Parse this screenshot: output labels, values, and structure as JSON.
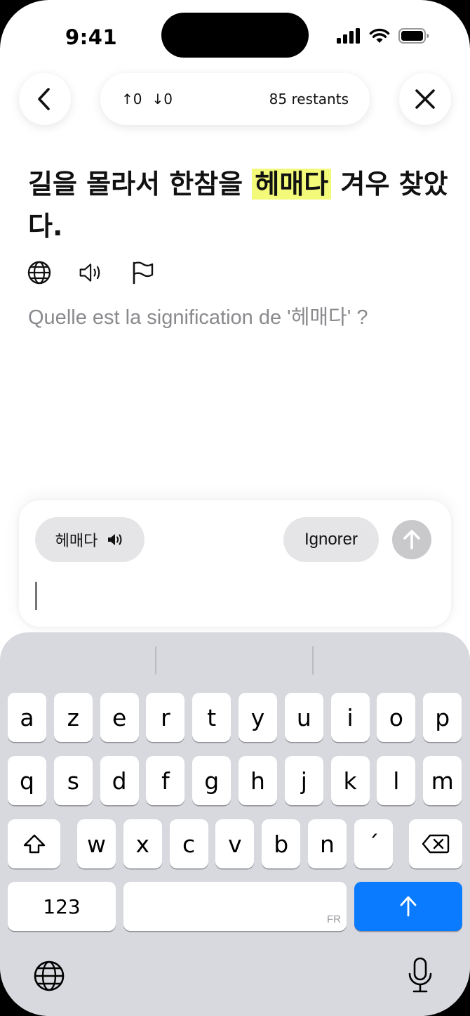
{
  "status_bar": {
    "time": "9:41"
  },
  "header": {
    "upvotes": "↑0",
    "downvotes": "↓0",
    "remaining": "85 restants"
  },
  "exercise": {
    "sentence_before": "길을 몰라서 한참을 ",
    "sentence_highlight": "헤매다",
    "sentence_after": " 겨우 찾았다.",
    "question": "Quelle est la signification de '헤매다' ?"
  },
  "composer": {
    "word_chip": "헤매다",
    "skip_label": "Ignorer"
  },
  "keyboard": {
    "row1": [
      "a",
      "z",
      "e",
      "r",
      "t",
      "y",
      "u",
      "i",
      "o",
      "p"
    ],
    "row2": [
      "q",
      "s",
      "d",
      "f",
      "g",
      "h",
      "j",
      "k",
      "l",
      "m"
    ],
    "row3": [
      "w",
      "x",
      "c",
      "v",
      "b",
      "n",
      "´"
    ],
    "numbers_label": "123",
    "space_lang": "FR"
  },
  "colors": {
    "highlight": "#f3fa7a",
    "return_key": "#0a7aff",
    "send_disabled": "#c9c9cc",
    "keyboard_bg": "#d7d9de"
  }
}
